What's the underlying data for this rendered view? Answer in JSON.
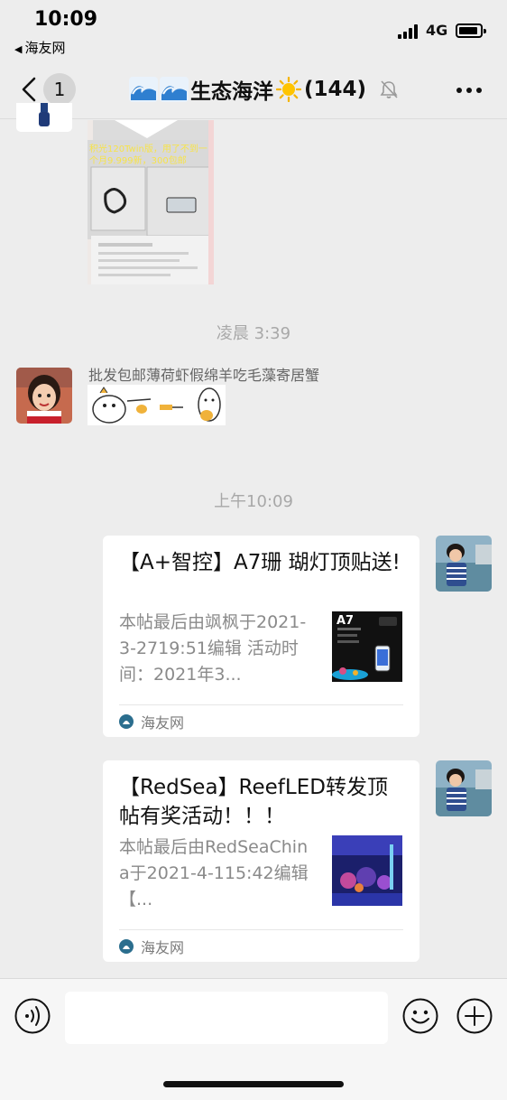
{
  "status_bar": {
    "time": "10:09",
    "back_app": "海友网",
    "network": "4G"
  },
  "nav": {
    "unread_count": "1",
    "title": "生态海洋",
    "member_count": "(144)"
  },
  "messages": {
    "image_caption": "积光120Twin版，用了不到一个月9.999新，300包邮",
    "timestamp_1": "凌晨 3:39",
    "sender_text": "批发包邮薄荷虾假绵羊吃毛藻寄居蟹",
    "timestamp_2": "上午10:09",
    "cards": [
      {
        "title": "【A+智控】A7珊 瑚灯顶贴送!",
        "desc": "本帖最后由飒枫于2021-3-2719:51编辑 活动时间：2021年3...",
        "thumb_label": "A7",
        "source": "海友网"
      },
      {
        "title": "【RedSea】ReefLED转发顶帖有奖活动！！！",
        "desc": "本帖最后由RedSeaChina于2021-4-115:42编辑【...",
        "source": "海友网"
      }
    ]
  },
  "colors": {
    "background": "#ededed",
    "card": "#ffffff",
    "muted_text": "#8a8a8a",
    "toolbar": "#f6f6f6"
  }
}
